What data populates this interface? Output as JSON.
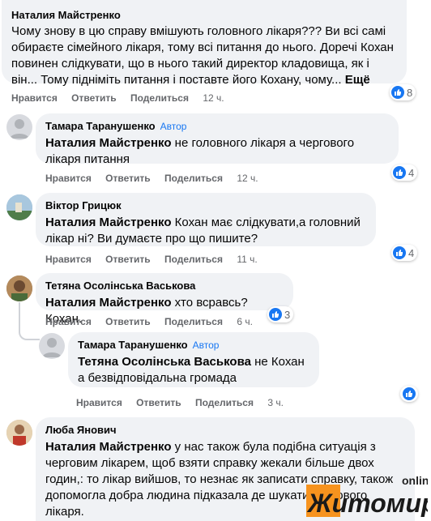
{
  "comments": [
    {
      "author": "Наталия Майстренко",
      "text": "Чому знову в цю справу вмішують головного лікаря??? Ви всі самі обираєте сімейного лікаря, тому всі питання до нього. Доречі Кохан повинен слідкувати, що в нього такий директор кладовища, як і він... Тому підніміть питання і поставте його Кохану, чому...",
      "more": "Ещё",
      "like_label": "Нравится",
      "reply_label": "Ответить",
      "share_label": "Поделиться",
      "time": "12 ч.",
      "reactions": "8"
    },
    {
      "author": "Тамара Таранушенко",
      "badge": "Автор",
      "mention": "Наталия Майстренко",
      "text": " не головного лікаря а чергового лікаря питання",
      "like_label": "Нравится",
      "reply_label": "Ответить",
      "share_label": "Поделиться",
      "time": "12 ч.",
      "reactions": "4"
    },
    {
      "author": "Віктор Грицюк",
      "mention": "Наталия Майстренко",
      "text": " Кохан має слідкувати,а головний лікар ні? Ви думаєте про що пишите?",
      "like_label": "Нравится",
      "reply_label": "Ответить",
      "share_label": "Поделиться",
      "time": "11 ч.",
      "reactions": "4"
    },
    {
      "author": "Тетяна Осолінська Васькова",
      "mention": "Наталия Майстренко",
      "text": " хто всравсь? Кохан.",
      "like_label": "Нравится",
      "reply_label": "Ответить",
      "share_label": "Поделиться",
      "time": "6 ч.",
      "reactions": "3"
    },
    {
      "author": "Тамара Таранушенко",
      "badge": "Автор",
      "mention": "Тетяна Осолінська Васькова",
      "text": " не Кохан а безвідповідальна громада",
      "like_label": "Нравится",
      "reply_label": "Ответить",
      "share_label": "Поделиться",
      "time": "3 ч."
    },
    {
      "author": "Люба Янович",
      "mention": "Наталия Майстренко",
      "text": " у нас також була подібна ситуація з черговим лікарем, щоб взяти справку жекали більше двох годин,: то лікар вийшов, то незнає як записати справку, також допомогла добра людина підказала де шукати чергового лікаря."
    }
  ],
  "watermark": {
    "online": "online",
    "name": "Житомир"
  },
  "colors": {
    "link_blue": "#1877f2",
    "bubble": "#f0f2f5",
    "meta_gray": "#65676b",
    "watermark_orange": "#f7931e"
  }
}
